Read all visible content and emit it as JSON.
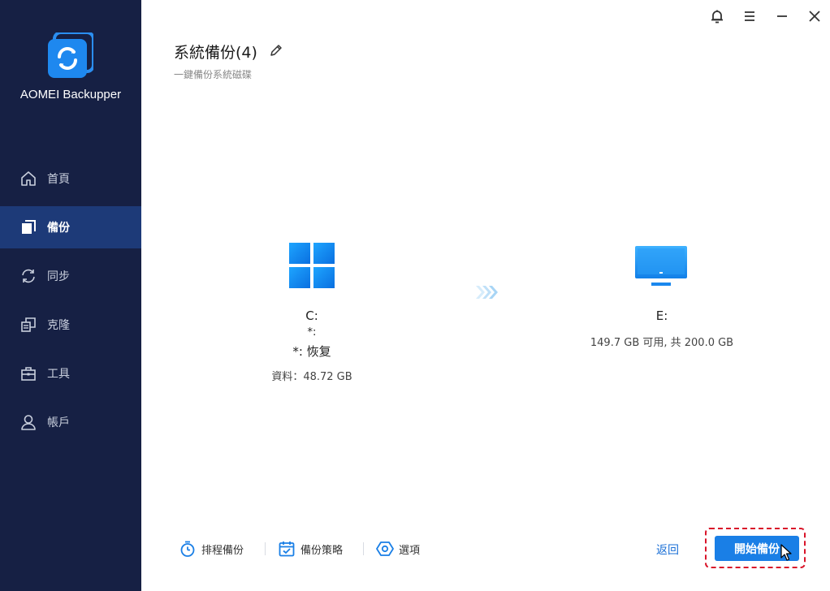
{
  "app": {
    "name": "AOMEI Backupper"
  },
  "sidebar": {
    "items": [
      {
        "label": "首頁",
        "icon": "home-icon",
        "active": false
      },
      {
        "label": "備份",
        "icon": "backup-icon",
        "active": true
      },
      {
        "label": "同步",
        "icon": "sync-icon",
        "active": false
      },
      {
        "label": "克隆",
        "icon": "clone-icon",
        "active": false
      },
      {
        "label": "工具",
        "icon": "tools-icon",
        "active": false
      },
      {
        "label": "帳戶",
        "icon": "user-icon",
        "active": false
      }
    ]
  },
  "header": {
    "title": "系統備份(4)",
    "subtitle": "一鍵備份系統磁碟"
  },
  "source": {
    "name": "C:",
    "line2": "*:",
    "line3": "*: 恢复",
    "data": "資料：48.72 GB",
    "icon": "windows-icon"
  },
  "destination": {
    "name": "E:",
    "free": "149.7 GB 可用, 共 200.0 GB",
    "icon": "monitor-icon"
  },
  "toolbar": {
    "schedule_label": "排程備份",
    "scheme_label": "備份策略",
    "options_label": "選項",
    "back_label": "返回",
    "start_label": "開始備份"
  },
  "colors": {
    "sidebar_bg": "#162044",
    "sidebar_active": "#1d3a78",
    "accent": "#1a7fe6",
    "highlight": "#d9152a"
  }
}
